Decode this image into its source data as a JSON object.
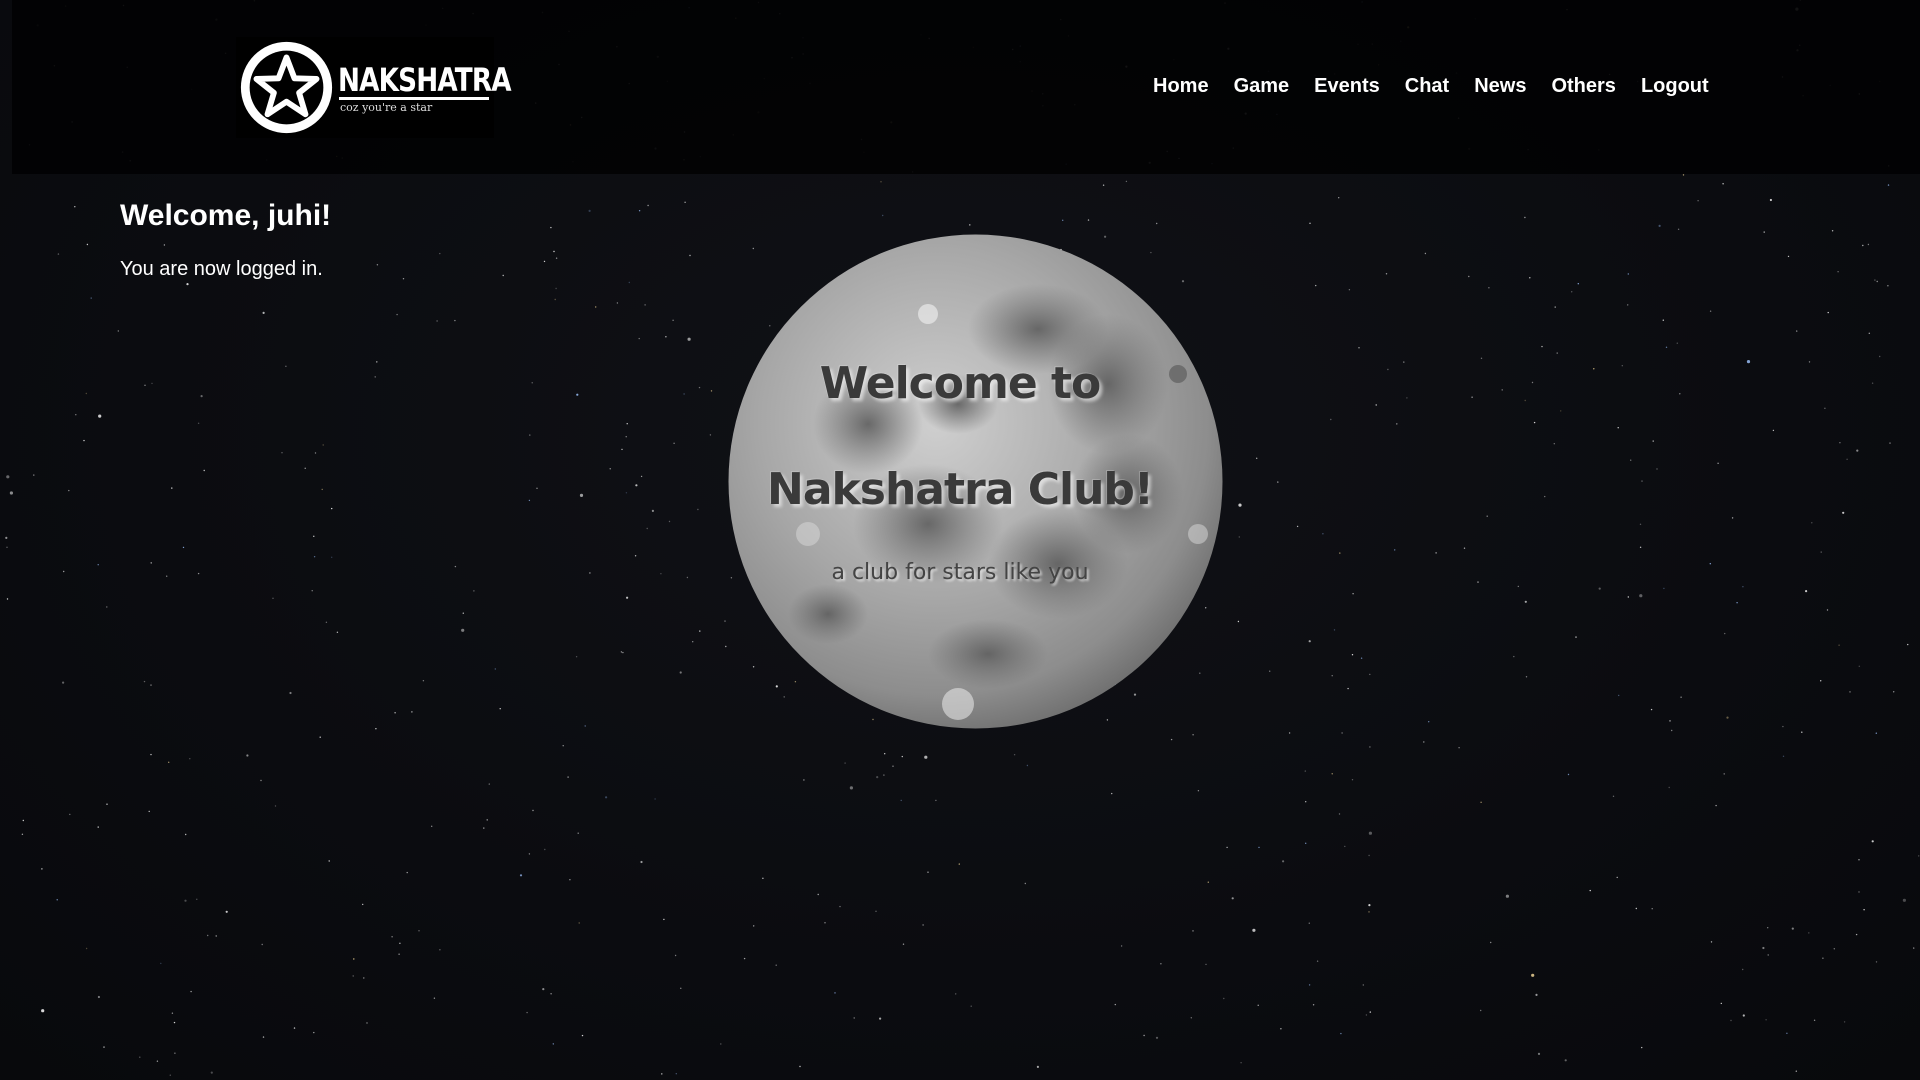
{
  "brand": {
    "name": "NAKSHATRA",
    "tagline": "coz you're a star",
    "logo_icon": "star-in-circle"
  },
  "nav": {
    "items": [
      {
        "label": "Home"
      },
      {
        "label": "Game"
      },
      {
        "label": "Events"
      },
      {
        "label": "Chat"
      },
      {
        "label": "News"
      },
      {
        "label": "Others"
      },
      {
        "label": "Logout"
      }
    ]
  },
  "session": {
    "welcome": "Welcome, juhi!",
    "status": "You are now logged in."
  },
  "hero": {
    "line1": "Welcome to",
    "line2": "Nakshatra Club!",
    "tagline": "a club for stars like you"
  },
  "colors": {
    "background": "#0b0c0f",
    "header": "#030304",
    "text": "#ffffff",
    "moon_text": "#3a3a3a"
  }
}
